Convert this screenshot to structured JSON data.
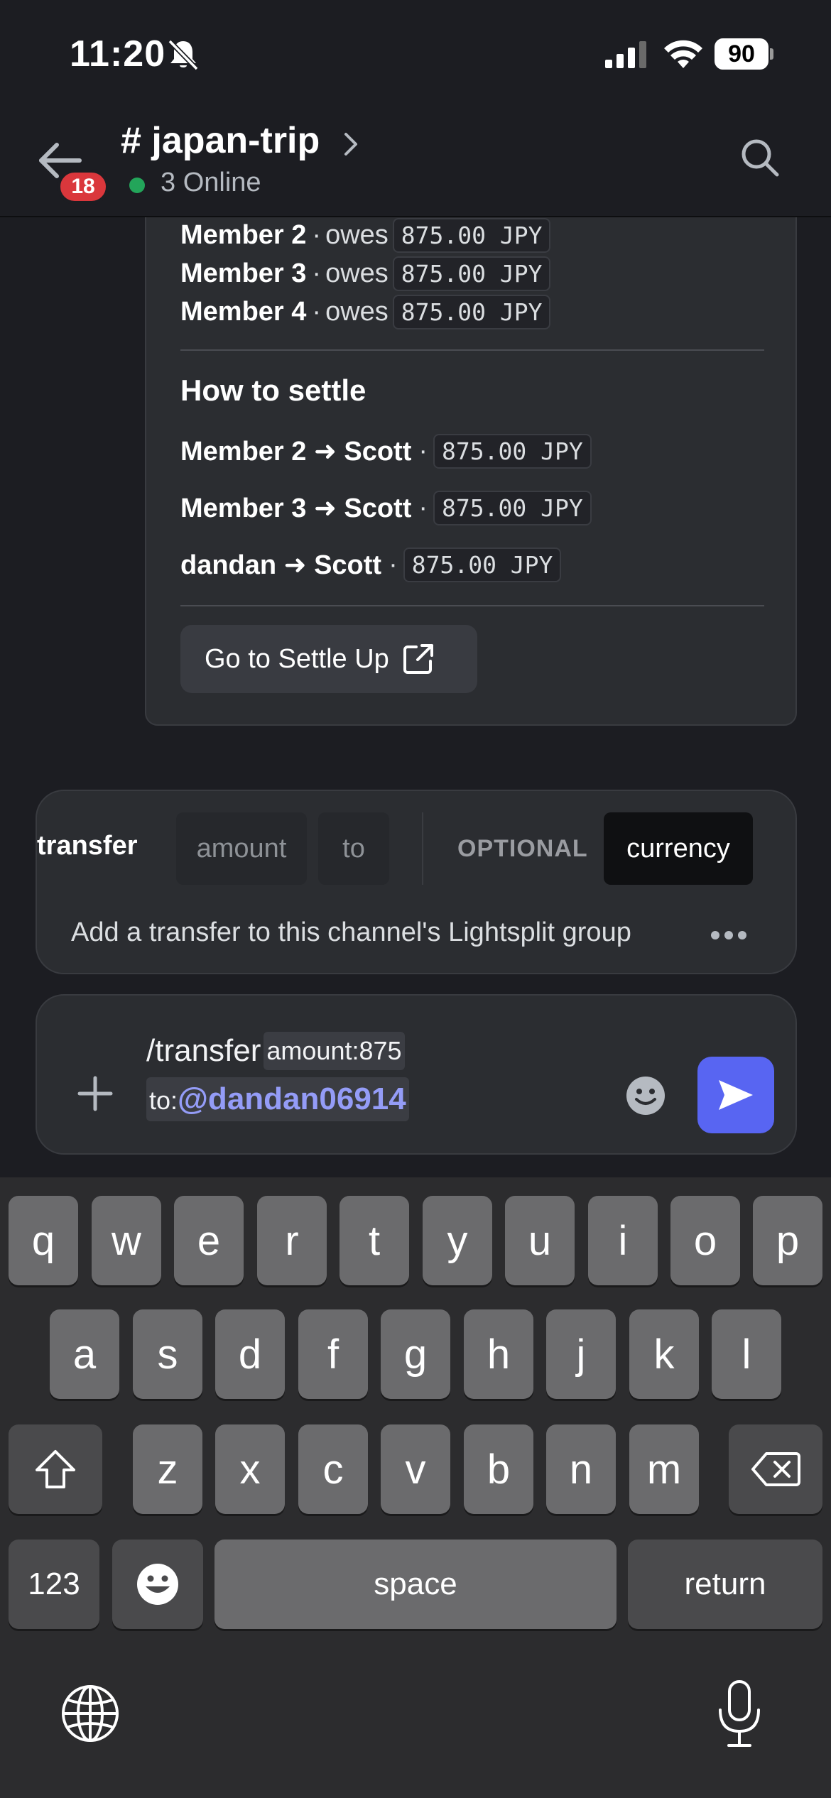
{
  "status_bar": {
    "time": "11:20",
    "battery_level": "90",
    "icons": [
      "bell-muted-icon",
      "signal-icon",
      "wifi-icon",
      "battery-icon"
    ]
  },
  "header": {
    "unread_badge": "18",
    "channel_title": "# japan-trip",
    "online_label": "3 Online",
    "icons": [
      "back-arrow-icon",
      "chevron-right-icon",
      "search-icon"
    ]
  },
  "embed": {
    "owes": [
      {
        "member": "Member 2",
        "sep": "·",
        "verb": "owes",
        "amount": "875.00 JPY"
      },
      {
        "member": "Member 3",
        "sep": "·",
        "verb": "owes",
        "amount": "875.00 JPY"
      },
      {
        "member": "Member 4",
        "sep": "·",
        "verb": "owes",
        "amount": "875.00 JPY"
      }
    ],
    "settle_heading": "How to settle",
    "settlements": [
      {
        "who": "Member 2 ➜ Scott",
        "sep": "·",
        "amount": "875.00 JPY"
      },
      {
        "who": "Member 3 ➜ Scott",
        "sep": "·",
        "amount": "875.00 JPY"
      },
      {
        "who": "dandan ➜ Scott",
        "sep": "·",
        "amount": "875.00 JPY"
      }
    ],
    "settle_button": "Go to Settle Up"
  },
  "command": {
    "name": "transfer",
    "options": {
      "amount": "amount",
      "to": "to",
      "optional_label": "OPTIONAL",
      "currency": "currency"
    },
    "description": "Add a transfer to this channel's Lightsplit group"
  },
  "composer": {
    "slash_text": "/transfer",
    "amount_param": "amount:",
    "amount_value": "875",
    "to_param": "to:",
    "mention": "@dandan06914"
  },
  "keyboard": {
    "row1": [
      "q",
      "w",
      "e",
      "r",
      "t",
      "y",
      "u",
      "i",
      "o",
      "p"
    ],
    "row2": [
      "a",
      "s",
      "d",
      "f",
      "g",
      "h",
      "j",
      "k",
      "l"
    ],
    "row3": [
      "z",
      "x",
      "c",
      "v",
      "b",
      "n",
      "m"
    ],
    "numbers_key": "123",
    "space_key": "space",
    "return_key": "return"
  },
  "colors": {
    "background": "#1c1d22",
    "card": "#2b2d31",
    "accent": "#5865f2",
    "mention": "#949cf7",
    "online": "#23a55a",
    "badge": "#da373c"
  }
}
